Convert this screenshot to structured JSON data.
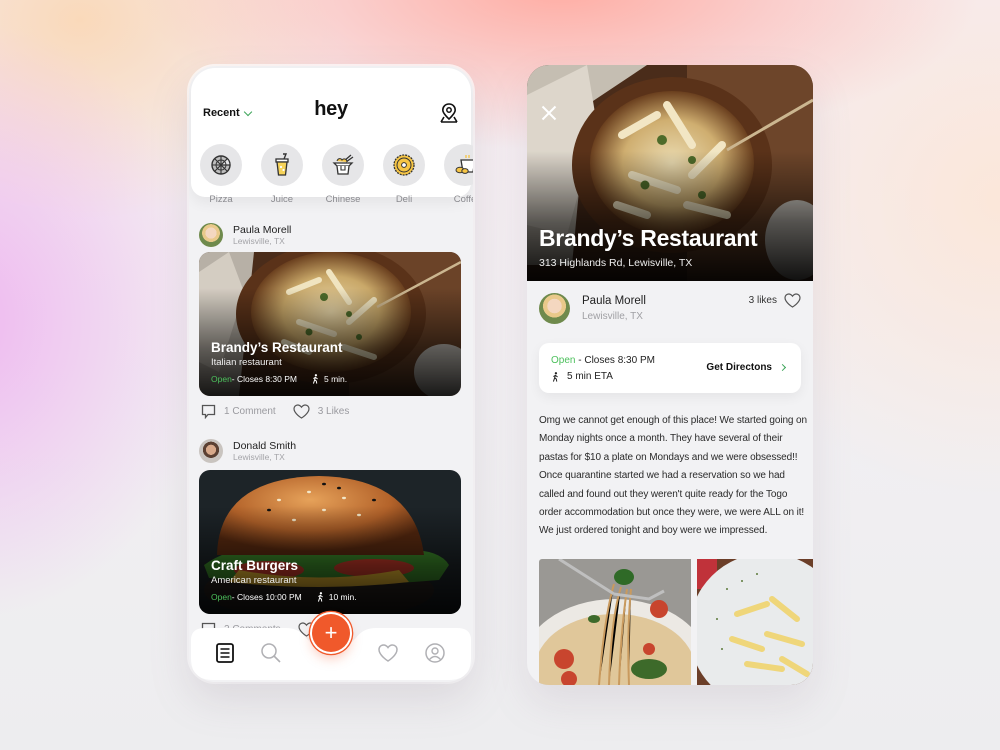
{
  "feed": {
    "header": {
      "filter_label": "Recent",
      "app_title": "hey"
    },
    "categories": [
      {
        "label": "Pizza",
        "icon": "pizza-icon"
      },
      {
        "label": "Juice",
        "icon": "juice-icon"
      },
      {
        "label": "Chinese",
        "icon": "takeout-box-icon"
      },
      {
        "label": "Deli",
        "icon": "deli-icon"
      },
      {
        "label": "Coffe",
        "icon": "coffee-icon"
      }
    ],
    "posts": [
      {
        "user_name": "Paula Morell",
        "user_location": "Lewisville, TX",
        "restaurant": "Brandy’s Restaurant",
        "cuisine": "Italian restaurant",
        "status": "Open",
        "closes": " - Closes 8:30 PM",
        "walk_time": "5 min.",
        "comments": "1 Comment",
        "likes": "3 Likes"
      },
      {
        "user_name": "Donald Smith",
        "user_location": "Lewisville, TX",
        "restaurant": "Craft Burgers",
        "cuisine": "American restaurant",
        "status": "Open",
        "closes": " - Closes 10:00 PM",
        "walk_time": "10 min.",
        "comments": "2 Comments",
        "likes": ""
      }
    ],
    "tabbar": {
      "items": [
        "feed-list",
        "search",
        "add",
        "favorites",
        "profile"
      ],
      "fab_label": "+"
    }
  },
  "detail": {
    "restaurant": "Brandy’s Restaurant",
    "address": "313 Highlands Rd, Lewisville, TX",
    "user_name": "Paula Morell",
    "user_location": "Lewisville, TX",
    "likes": "3 likes",
    "status": "Open",
    "closes": " - Closes 8:30 PM",
    "eta": "5 min ETA",
    "directions_label": "Get Directons",
    "review": "Omg we cannot get enough of this place! We started going on Monday nights once a month. They have several of their pastas for $10 a plate on Mondays and we were obsessed!! Once quarantine started we had a reservation so we had called and found out they weren't quite ready for the Togo order accommodation but once they were, we were ALL on it! We just ordered tonight and boy were we impressed."
  },
  "colors": {
    "accent": "#f0592b",
    "open": "#4cc05c",
    "chevron": "#3ea55a"
  }
}
